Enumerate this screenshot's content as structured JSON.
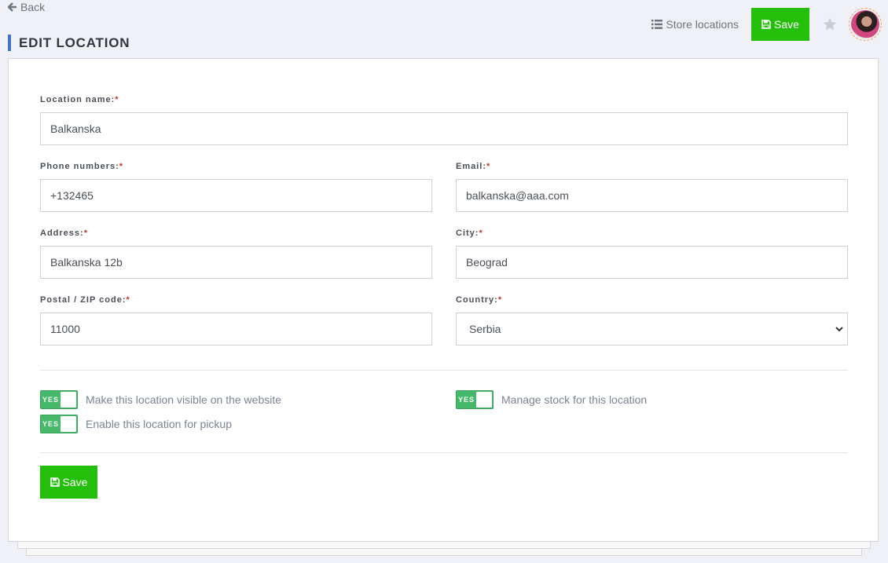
{
  "header": {
    "back_label": "Back",
    "page_title": "EDIT LOCATION",
    "store_locations_label": "Store locations",
    "save_label": "Save"
  },
  "form": {
    "location_name": {
      "label": "Location name:",
      "required": "*",
      "value": "Balkanska"
    },
    "phone": {
      "label": "Phone numbers:",
      "required": "*",
      "value": "+132465"
    },
    "email": {
      "label": "Email:",
      "required": "*",
      "value": "balkanska@aaa.com"
    },
    "address": {
      "label": "Address:",
      "required": "*",
      "value": "Balkanska 12b"
    },
    "city": {
      "label": "City:",
      "required": "*",
      "value": "Beograd"
    },
    "postal": {
      "label": "Postal / ZIP code:",
      "required": "*",
      "value": "11000"
    },
    "country": {
      "label": "Country:",
      "required": "*",
      "value": "Serbia",
      "options": [
        "Serbia"
      ]
    }
  },
  "toggles": [
    {
      "state_label": "YES",
      "label": "Make this location visible on the website",
      "on": true
    },
    {
      "state_label": "YES",
      "label": "Enable this location for pickup",
      "on": true
    },
    {
      "state_label": "YES",
      "label": "Manage stock for this location",
      "on": true
    }
  ],
  "footer": {
    "save_label": "Save"
  },
  "colors": {
    "accent": "#3c76c4",
    "save": "#23bf0b",
    "toggle_on": "#45b86a",
    "required": "#c0392b"
  }
}
